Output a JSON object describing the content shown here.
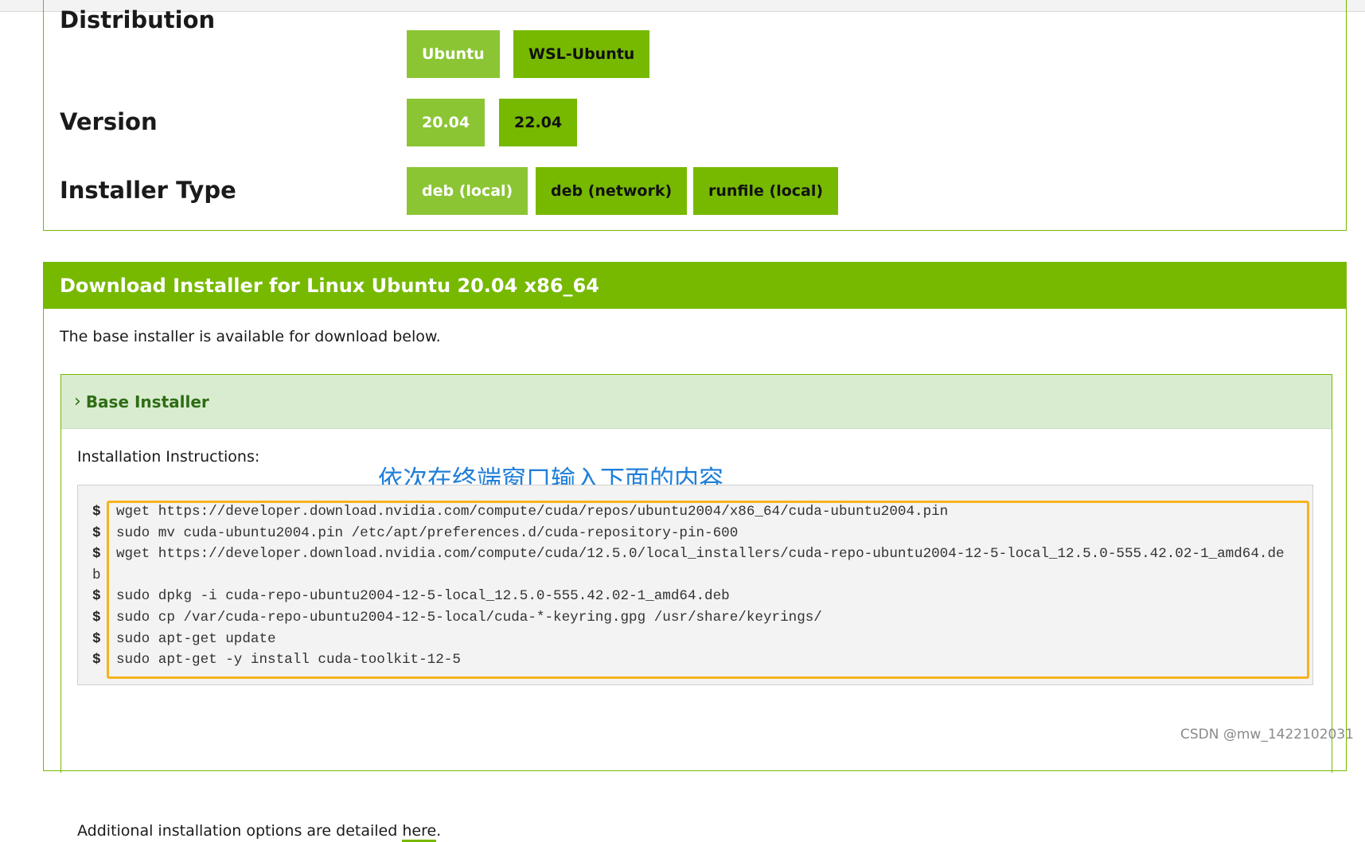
{
  "selector": {
    "distribution": {
      "label": "Distribution",
      "options": [
        {
          "label": "Ubuntu",
          "selected": true
        },
        {
          "label": "WSL-Ubuntu",
          "selected": false
        }
      ]
    },
    "version": {
      "label": "Version",
      "options": [
        {
          "label": "20.04",
          "selected": true
        },
        {
          "label": "22.04",
          "selected": false
        }
      ]
    },
    "installer_type": {
      "label": "Installer Type",
      "options": [
        {
          "label": "deb (local)",
          "selected": true
        },
        {
          "label": "deb (network)",
          "selected": false
        },
        {
          "label": "runfile (local)",
          "selected": false
        }
      ]
    }
  },
  "download": {
    "title": "Download Installer for Linux Ubuntu 20.04 x86_64",
    "description": "The base installer is available for download below.",
    "base_installer": {
      "title": "Base Installer",
      "instructions_label": "Installation Instructions:",
      "commands": [
        {
          "prompt": "$",
          "text": "wget https://developer.download.nvidia.com/compute/cuda/repos/ubuntu2004/x86_64/cuda-ubuntu2004.pin"
        },
        {
          "prompt": "$",
          "text": "sudo mv cuda-ubuntu2004.pin /etc/apt/preferences.d/cuda-repository-pin-600"
        },
        {
          "prompt": "$",
          "text": "wget https://developer.download.nvidia.com/compute/cuda/12.5.0/local_installers/cuda-repo-ubuntu2004-12-5-local_12.5.0-555.42.02-1_amd64.de"
        },
        {
          "prompt": "",
          "text": "b"
        },
        {
          "prompt": "$",
          "text": "sudo dpkg -i cuda-repo-ubuntu2004-12-5-local_12.5.0-555.42.02-1_amd64.deb"
        },
        {
          "prompt": "$",
          "text": "sudo cp /var/cuda-repo-ubuntu2004-12-5-local/cuda-*-keyring.gpg /usr/share/keyrings/"
        },
        {
          "prompt": "$",
          "text": "sudo apt-get update"
        },
        {
          "prompt": "$",
          "text": "sudo apt-get -y install cuda-toolkit-12-5"
        }
      ]
    },
    "additional_prefix": "Additional installation options are detailed ",
    "additional_link": "here",
    "additional_suffix": "."
  },
  "annotation": "依次在终端窗口输入下面的内容",
  "watermark": "CSDN @mw_1422102031",
  "colors": {
    "brand_green": "#76b900",
    "selected_green": "#8bc534",
    "installer_header_bg": "#d9ecd0",
    "highlight_border": "#f7b21e",
    "annotation_blue": "#1f7fd8"
  }
}
